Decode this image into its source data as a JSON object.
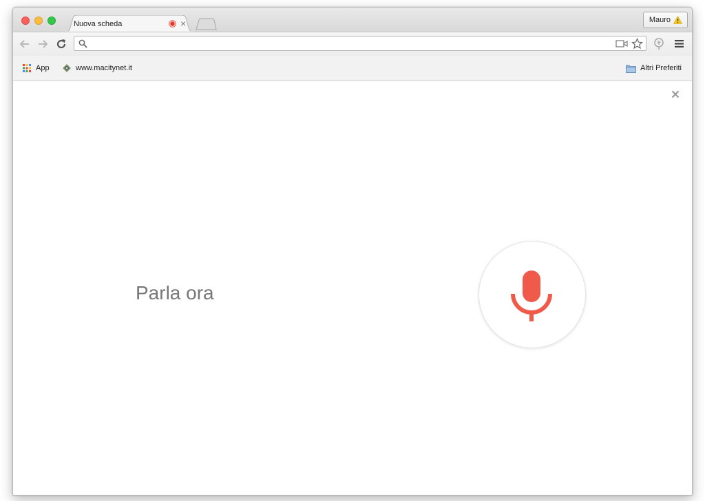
{
  "tab": {
    "title": "Nuova scheda",
    "close_glyph": "×"
  },
  "profile": {
    "name": "Mauro"
  },
  "omnibox": {
    "value": "",
    "placeholder": ""
  },
  "bookmarks": {
    "apps_label": "App",
    "site_label": "www.macitynet.it",
    "other_label": "Altri Preferiti"
  },
  "voice_search": {
    "prompt": "Parla ora"
  },
  "colors": {
    "mic_red": "#f05a4a",
    "traffic_close": "#fc605c",
    "traffic_min": "#fdbc40",
    "traffic_max": "#34c84a",
    "prompt_gray": "#777777"
  },
  "icons": {
    "back": "arrow-left-icon",
    "forward": "arrow-right-icon",
    "reload": "reload-icon",
    "search": "search-icon",
    "camera": "camera-icon",
    "star": "star-icon",
    "extension": "extension-icon",
    "menu": "hamburger-menu-icon",
    "apps": "apps-grid-icon",
    "folder": "folder-icon",
    "mic": "microphone-icon",
    "warning": "warning-icon",
    "recording": "recording-icon",
    "close": "close-icon"
  }
}
